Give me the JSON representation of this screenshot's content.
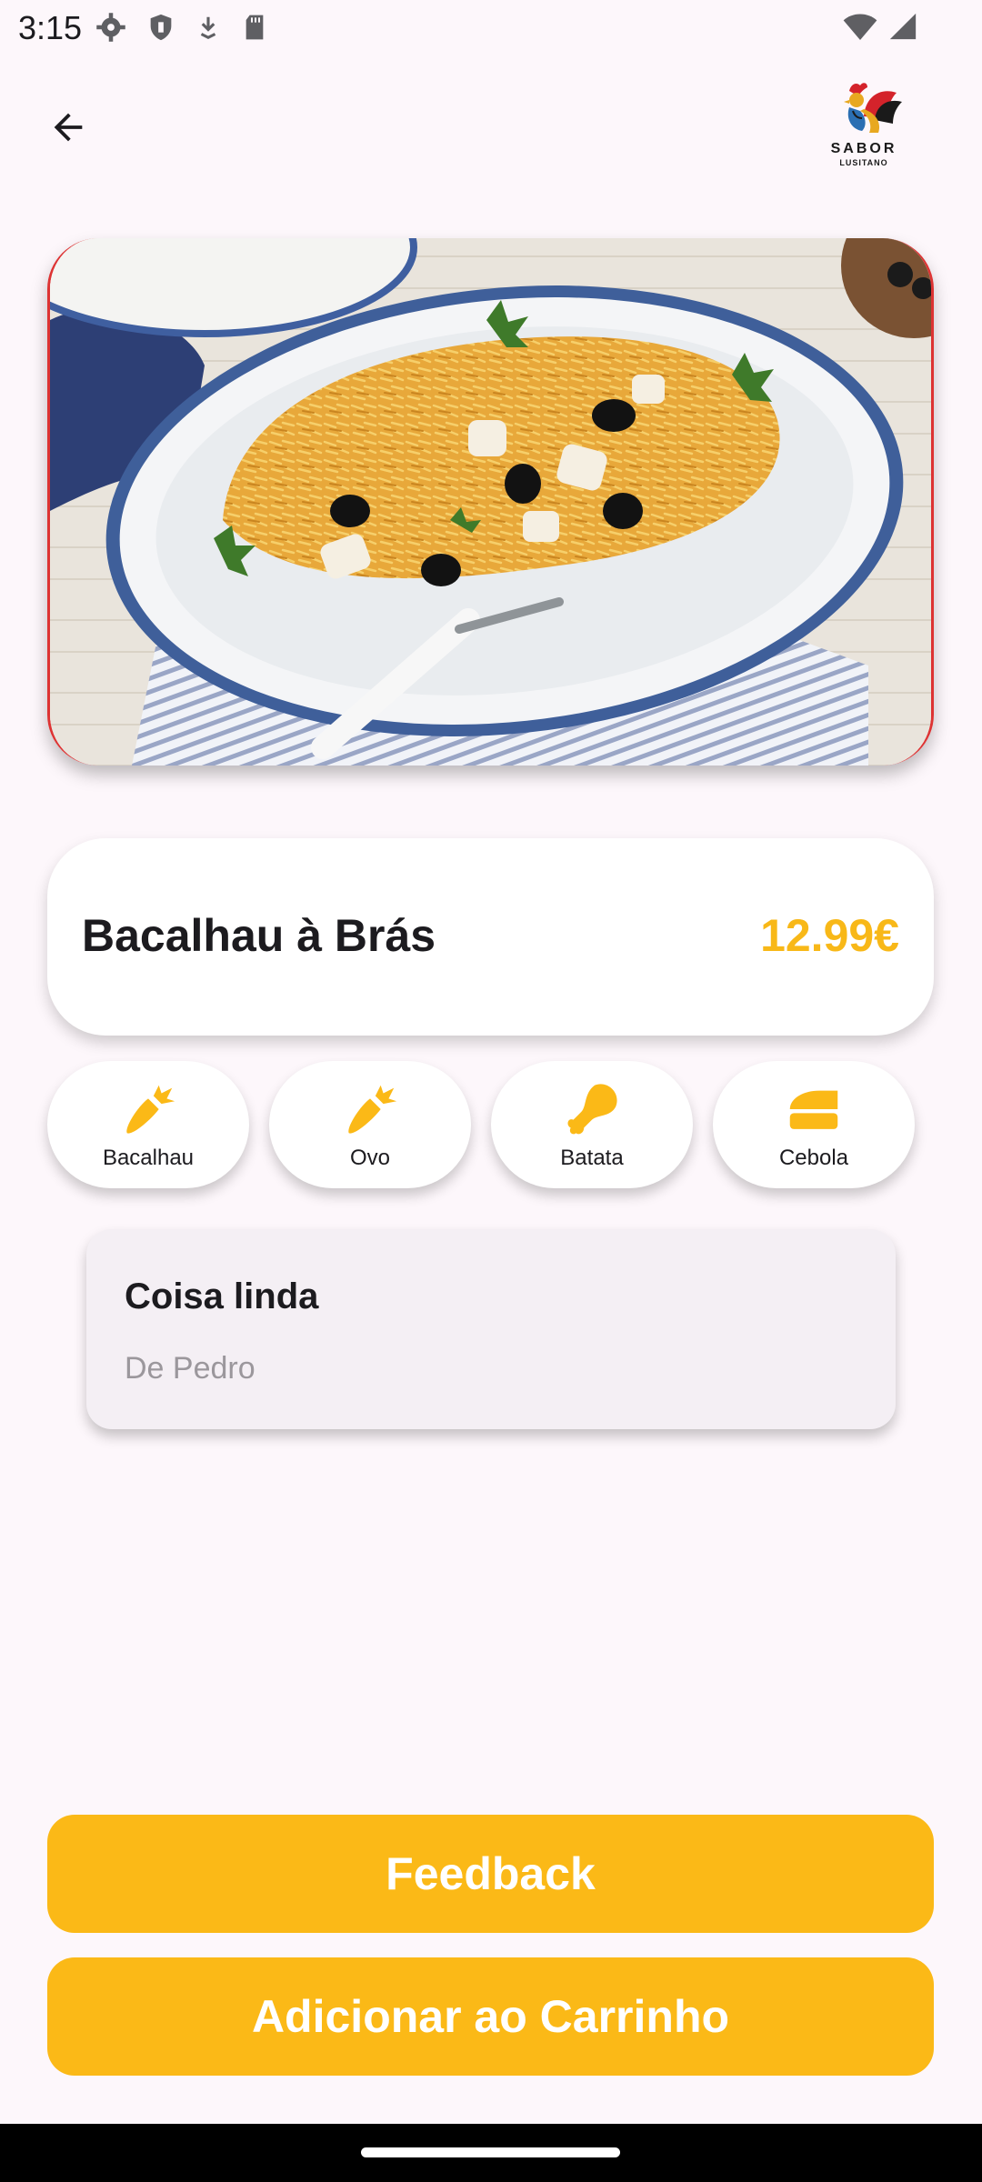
{
  "status_bar": {
    "time": "3:15",
    "icons": [
      "settings-icon",
      "shield-icon",
      "download-icon",
      "sd-card-icon",
      "wifi-icon",
      "signal-icon"
    ]
  },
  "header": {
    "back_icon": "arrow-left-icon",
    "logo": {
      "line1": "SABOR",
      "line2": "LUSITANO"
    }
  },
  "dish": {
    "name": "Bacalhau à Brás",
    "price": "12.99€",
    "price_color": "#f8b818"
  },
  "ingredients": [
    {
      "label": "Bacalhau",
      "icon": "carrot-icon"
    },
    {
      "label": "Ovo",
      "icon": "carrot-icon"
    },
    {
      "label": "Batata",
      "icon": "drumstick-icon"
    },
    {
      "label": "Cebola",
      "icon": "cake-icon"
    }
  ],
  "review": {
    "title": "Coisa linda",
    "author": "De Pedro"
  },
  "actions": {
    "feedback_label": "Feedback",
    "add_to_cart_label": "Adicionar ao Carrinho",
    "accent_color": "#fbb917"
  }
}
